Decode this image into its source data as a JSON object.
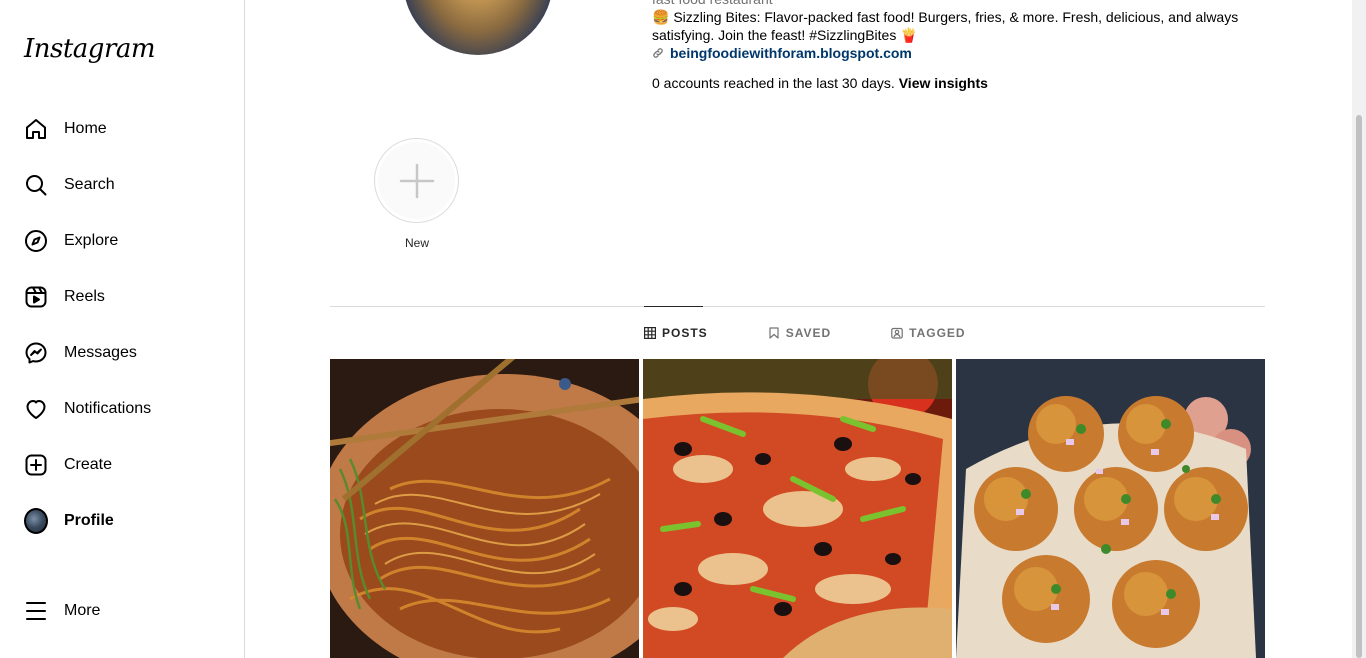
{
  "app": {
    "logo": "Instagram"
  },
  "sidebar": {
    "items": [
      {
        "label": "Home",
        "icon": "home-icon"
      },
      {
        "label": "Search",
        "icon": "search-icon"
      },
      {
        "label": "Explore",
        "icon": "compass-icon"
      },
      {
        "label": "Reels",
        "icon": "reels-icon"
      },
      {
        "label": "Messages",
        "icon": "messenger-icon"
      },
      {
        "label": "Notifications",
        "icon": "heart-icon"
      },
      {
        "label": "Create",
        "icon": "plus-square-icon"
      },
      {
        "label": "Profile",
        "icon": "avatar"
      },
      {
        "label": "More",
        "icon": "hamburger-icon"
      }
    ]
  },
  "profile": {
    "category": "fast food restaurant",
    "bio_line": "🍔 Sizzling Bites: Flavor-packed fast food! Burgers, fries, & more. Fresh, delicious, and always satisfying. Join the feast! #SizzlingBites 🍟",
    "link": "beingfoodiewithforam.blogspot.com",
    "insights_text": "0 accounts reached in the last 30 days.",
    "insights_link": "View insights"
  },
  "highlights": {
    "new_label": "New"
  },
  "tabs": [
    {
      "label": "POSTS",
      "icon": "grid-icon",
      "active": true
    },
    {
      "label": "SAVED",
      "icon": "bookmark-icon",
      "active": false
    },
    {
      "label": "TAGGED",
      "icon": "tag-user-icon",
      "active": false
    }
  ],
  "colors": {
    "text": "#262626",
    "muted": "#737373",
    "link": "#00376b",
    "border": "#dbdbdb"
  }
}
